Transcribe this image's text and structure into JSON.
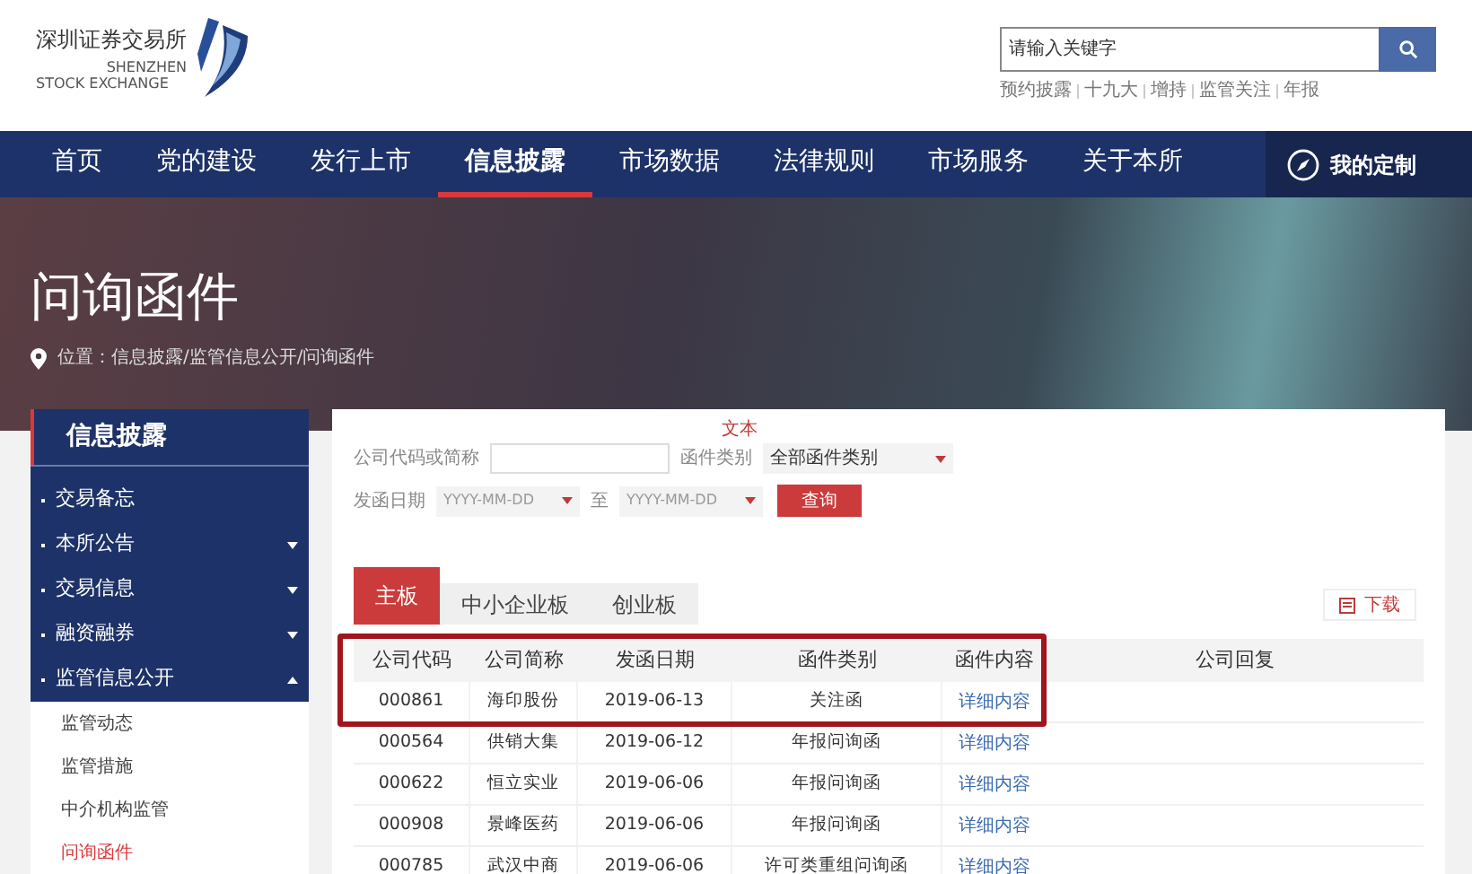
{
  "header": {
    "logo": {
      "name_cn": "深圳证券交易所",
      "name_en_1": "SHENZHEN",
      "name_en_2": "STOCK EXCHANGE"
    },
    "search": {
      "placeholder": "请输入关键字"
    },
    "quick_links": [
      "预约披露",
      "十九大",
      "增持",
      "监管关注",
      "年报"
    ]
  },
  "nav": {
    "items": [
      {
        "label": "首页",
        "selected": false
      },
      {
        "label": "党的建设",
        "selected": false
      },
      {
        "label": "发行上市",
        "selected": false
      },
      {
        "label": "信息披露",
        "selected": true
      },
      {
        "label": "市场数据",
        "selected": false
      },
      {
        "label": "法律规则",
        "selected": false
      },
      {
        "label": "市场服务",
        "selected": false
      },
      {
        "label": "关于本所",
        "selected": false
      }
    ],
    "custom": "我的定制"
  },
  "banner": {
    "title": "问询函件",
    "breadcrumb": "位置：信息披露/监管信息公开/问询函件"
  },
  "sidebar": {
    "title": "信息披露",
    "items": [
      {
        "label": "交易备忘",
        "kind": "leaf"
      },
      {
        "label": "本所公告",
        "kind": "group",
        "expanded": false
      },
      {
        "label": "交易信息",
        "kind": "group",
        "expanded": false
      },
      {
        "label": "融资融券",
        "kind": "group",
        "expanded": false
      },
      {
        "label": "监管信息公开",
        "kind": "group",
        "expanded": true,
        "children": [
          {
            "label": "监管动态",
            "selected": false
          },
          {
            "label": "监管措施",
            "selected": false
          },
          {
            "label": "中介机构监管",
            "selected": false
          },
          {
            "label": "问询函件",
            "selected": true
          }
        ]
      }
    ]
  },
  "filter": {
    "note": "文本",
    "company_label": "公司代码或简称",
    "type_label": "函件类别",
    "type_value": "全部函件类别",
    "date_label": "发函日期",
    "date_from": "YYYY-MM-DD",
    "date_sep": "至",
    "date_to": "YYYY-MM-DD",
    "search_button": "查询"
  },
  "tabs": [
    {
      "label": "主板",
      "selected": true
    },
    {
      "label": "中小企业板",
      "selected": false
    },
    {
      "label": "创业板",
      "selected": false
    }
  ],
  "download": "下载",
  "table": {
    "callout": true,
    "columns": [
      "公司代码",
      "公司简称",
      "发函日期",
      "函件类别",
      "函件内容",
      "公司回复"
    ],
    "rows": [
      {
        "code": "000861",
        "name": "海印股份",
        "date": "2019-06-13",
        "type": "关注函",
        "content": "详细内容"
      },
      {
        "code": "000564",
        "name": "供销大集",
        "date": "2019-06-12",
        "type": "年报问询函",
        "content": "详细内容"
      },
      {
        "code": "000622",
        "name": "恒立实业",
        "date": "2019-06-06",
        "type": "年报问询函",
        "content": "详细内容"
      },
      {
        "code": "000908",
        "name": "景峰医药",
        "date": "2019-06-06",
        "type": "年报问询函",
        "content": "详细内容"
      },
      {
        "code": "000785",
        "name": "武汉中商",
        "date": "2019-06-06",
        "type": "许可类重组问询函",
        "content": "详细内容"
      }
    ]
  }
}
